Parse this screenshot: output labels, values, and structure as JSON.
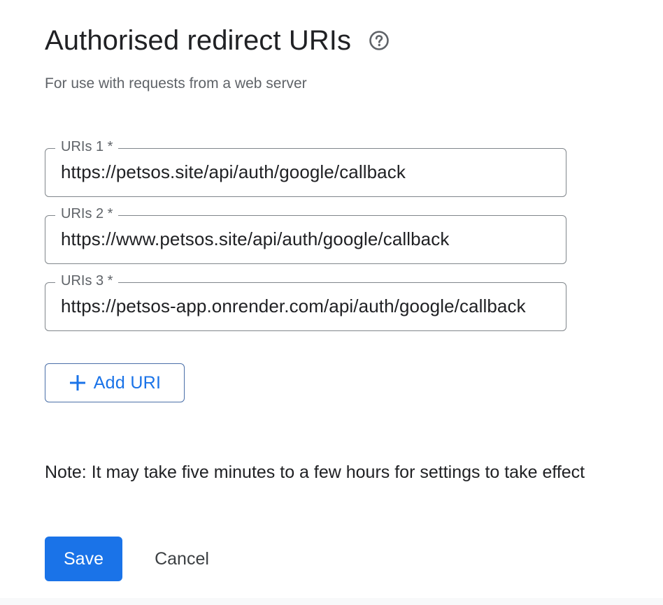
{
  "section": {
    "title": "Authorised redirect URIs",
    "help_icon": "help-circle-icon",
    "subtitle": "For use with requests from a web server"
  },
  "uris": [
    {
      "label": "URIs 1 *",
      "value": "https://petsos.site/api/auth/google/callback"
    },
    {
      "label": "URIs 2 *",
      "value": "https://www.petsos.site/api/auth/google/callback"
    },
    {
      "label": "URIs 3 *",
      "value": "https://petsos-app.onrender.com/api/auth/google/callback"
    }
  ],
  "add_uri": {
    "icon": "plus-icon",
    "label": "Add URI"
  },
  "note": "Note: It may take five minutes to a few hours for settings to take effect",
  "actions": {
    "save_label": "Save",
    "cancel_label": "Cancel"
  },
  "colors": {
    "primary": "#1a73e8",
    "text": "#202124",
    "secondary_text": "#5f6368",
    "border": "#80868b"
  }
}
